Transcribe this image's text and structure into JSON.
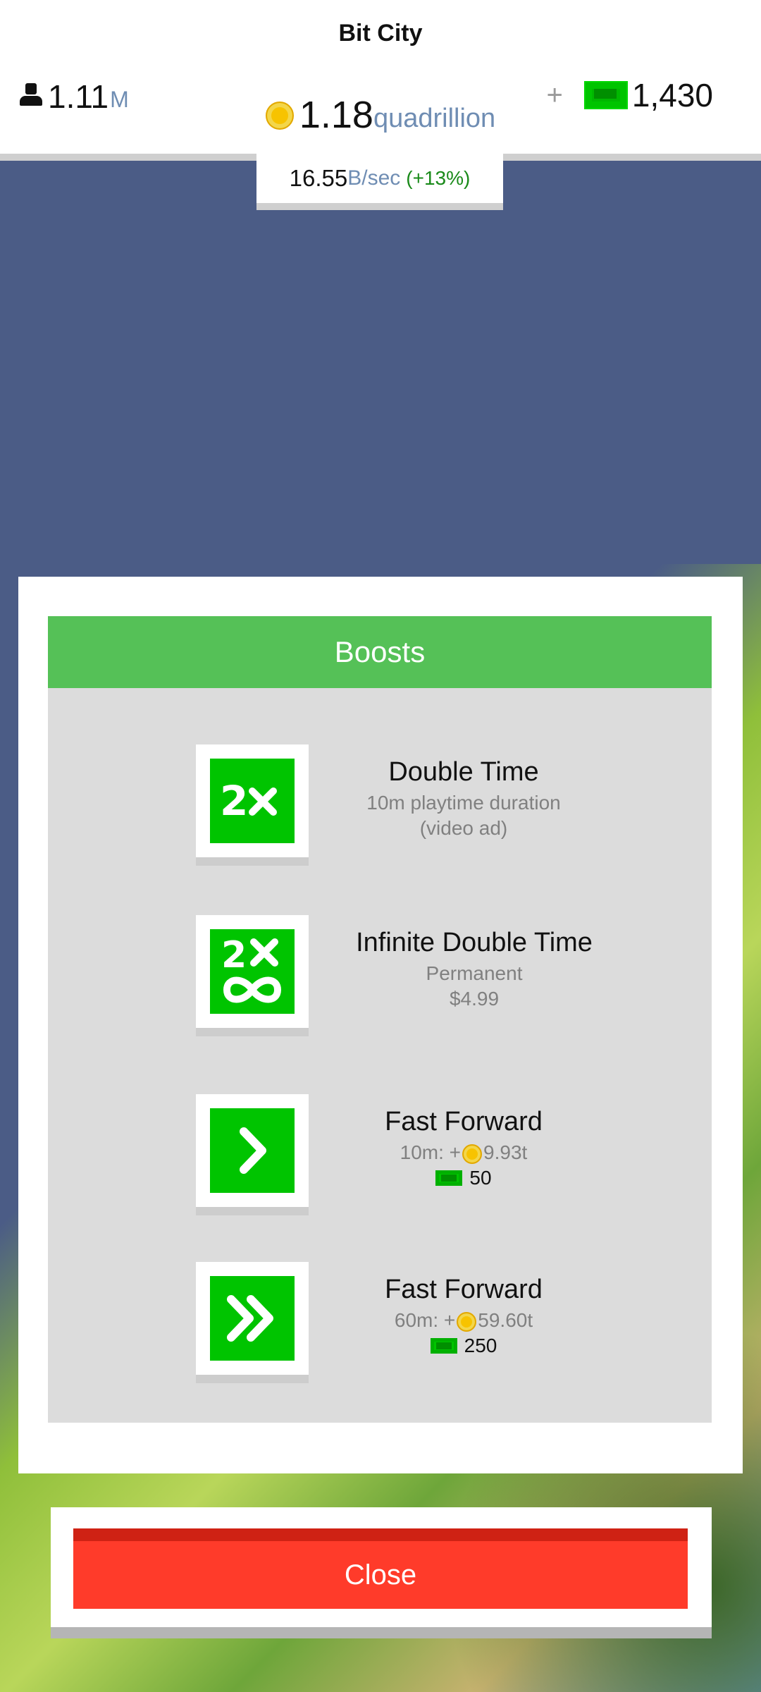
{
  "app_title": "Bit City",
  "header": {
    "population_value": "1.11",
    "population_unit": "M",
    "coins_value": "1.18",
    "coins_unit": "quadrillion",
    "cash_plus": "+",
    "cash_value": "1,430",
    "rate_value": "16.55",
    "rate_unit": "B/sec",
    "rate_bonus": "(+13%)"
  },
  "panel": {
    "title": "Boosts",
    "boosts": [
      {
        "icon": "double-time-icon",
        "title": "Double Time",
        "line1": "10m playtime duration",
        "line2": "(video ad)"
      },
      {
        "icon": "infinite-double-time-icon",
        "title": "Infinite Double Time",
        "line1": "Permanent",
        "line2": "$4.99"
      },
      {
        "icon": "fast-forward-icon",
        "title": "Fast Forward",
        "line1_prefix": "10m: +",
        "line1_value": "9.93t",
        "cost": "50"
      },
      {
        "icon": "fast-forward-double-icon",
        "title": "Fast Forward",
        "line1_prefix": "60m: +",
        "line1_value": "59.60t",
        "cost": "250"
      }
    ]
  },
  "close_label": "Close",
  "colors": {
    "sky": "#4b5c86",
    "green_header": "#55c157",
    "tile_green": "#00c400",
    "close_red": "#ff3b2a"
  }
}
